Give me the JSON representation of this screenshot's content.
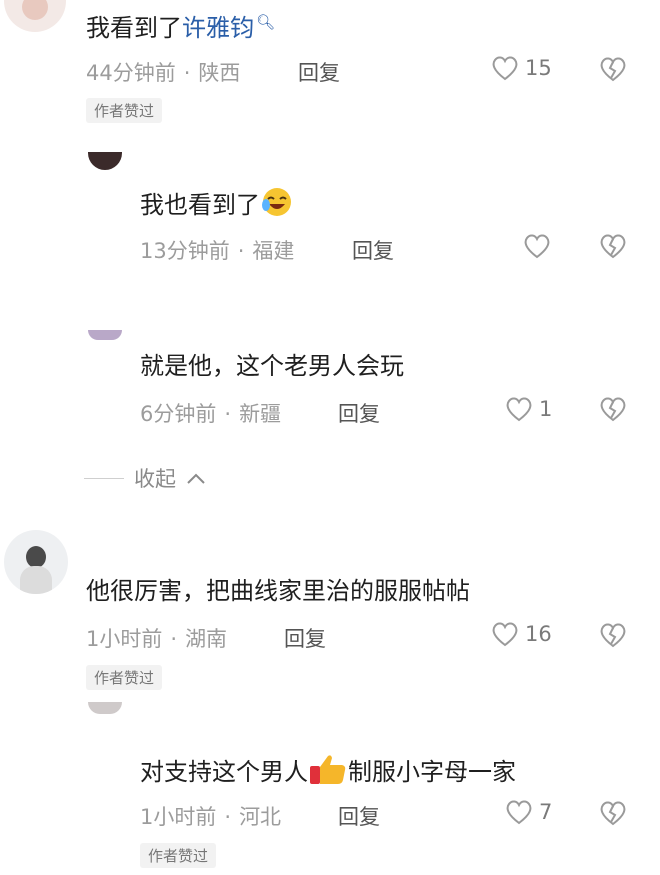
{
  "comments": [
    {
      "text": "我看到了",
      "mention": "许雅钧",
      "time": "44分钟前",
      "location": "陕西",
      "reply_label": "回复",
      "likes": "15",
      "badge": "作者赞过"
    },
    {
      "text": "我也看到了",
      "time": "13分钟前",
      "location": "福建",
      "reply_label": "回复",
      "likes": "",
      "emoji": "laughing-tears-emoji"
    },
    {
      "text": "就是他，这个老男人会玩",
      "time": "6分钟前",
      "location": "新疆",
      "reply_label": "回复",
      "likes": "1"
    },
    {
      "text": "他很厉害，把曲线家里治的服服帖帖",
      "time": "1小时前",
      "location": "湖南",
      "reply_label": "回复",
      "likes": "16",
      "badge": "作者赞过"
    },
    {
      "text_before": "对支持这个男人",
      "text_after": "制服小字母一家",
      "time": "1小时前",
      "location": "河北",
      "reply_label": "回复",
      "likes": "7",
      "badge": "作者赞过",
      "emoji": "thumbs-up-emoji"
    }
  ],
  "collapse_label": "收起",
  "colors": {
    "meta_gray": "#9c9c9c",
    "mention_blue": "#2a5ea8",
    "badge_bg": "#f2f2f2"
  }
}
